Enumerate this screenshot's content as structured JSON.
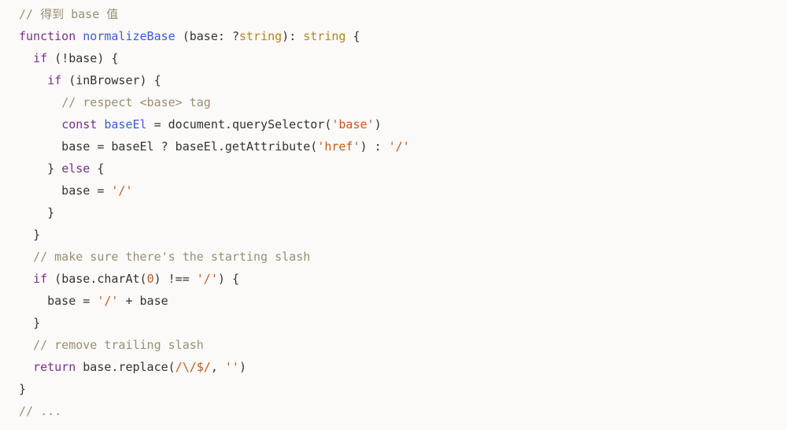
{
  "code": {
    "tokens": [
      [
        [
          "comment",
          "// 得到 base 值"
        ]
      ],
      [
        [
          "keyword",
          "function"
        ],
        [
          "plain",
          " "
        ],
        [
          "funcname",
          "normalizeBase"
        ],
        [
          "plain",
          " "
        ],
        [
          "paren",
          "("
        ],
        [
          "plain",
          "base"
        ],
        [
          "op",
          ":"
        ],
        [
          "plain",
          " "
        ],
        [
          "op",
          "?"
        ],
        [
          "builtin",
          "string"
        ],
        [
          "paren",
          ")"
        ],
        [
          "op",
          ":"
        ],
        [
          "plain",
          " "
        ],
        [
          "builtin",
          "string"
        ],
        [
          "plain",
          " "
        ],
        [
          "paren",
          "{"
        ]
      ],
      [
        [
          "plain",
          "  "
        ],
        [
          "keyword",
          "if"
        ],
        [
          "plain",
          " "
        ],
        [
          "paren",
          "("
        ],
        [
          "op",
          "!"
        ],
        [
          "plain",
          "base"
        ],
        [
          "paren",
          ")"
        ],
        [
          "plain",
          " "
        ],
        [
          "paren",
          "{"
        ]
      ],
      [
        [
          "plain",
          "    "
        ],
        [
          "keyword",
          "if"
        ],
        [
          "plain",
          " "
        ],
        [
          "paren",
          "("
        ],
        [
          "plain",
          "inBrowser"
        ],
        [
          "paren",
          ")"
        ],
        [
          "plain",
          " "
        ],
        [
          "paren",
          "{"
        ]
      ],
      [
        [
          "plain",
          "      "
        ],
        [
          "comment",
          "// respect <base> tag"
        ]
      ],
      [
        [
          "plain",
          "      "
        ],
        [
          "keyword",
          "const"
        ],
        [
          "plain",
          " "
        ],
        [
          "funcname",
          "baseEl"
        ],
        [
          "plain",
          " "
        ],
        [
          "op",
          "="
        ],
        [
          "plain",
          " document"
        ],
        [
          "op",
          "."
        ],
        [
          "plain",
          "querySelector"
        ],
        [
          "paren",
          "("
        ],
        [
          "string",
          "'base'"
        ],
        [
          "paren",
          ")"
        ]
      ],
      [
        [
          "plain",
          "      base "
        ],
        [
          "op",
          "="
        ],
        [
          "plain",
          " baseEl "
        ],
        [
          "op",
          "?"
        ],
        [
          "plain",
          " baseEl"
        ],
        [
          "op",
          "."
        ],
        [
          "plain",
          "getAttribute"
        ],
        [
          "paren",
          "("
        ],
        [
          "string",
          "'href'"
        ],
        [
          "paren",
          ")"
        ],
        [
          "plain",
          " "
        ],
        [
          "op",
          ":"
        ],
        [
          "plain",
          " "
        ],
        [
          "string",
          "'/'"
        ]
      ],
      [
        [
          "plain",
          "    "
        ],
        [
          "paren",
          "}"
        ],
        [
          "plain",
          " "
        ],
        [
          "keyword",
          "else"
        ],
        [
          "plain",
          " "
        ],
        [
          "paren",
          "{"
        ]
      ],
      [
        [
          "plain",
          "      base "
        ],
        [
          "op",
          "="
        ],
        [
          "plain",
          " "
        ],
        [
          "string",
          "'/'"
        ]
      ],
      [
        [
          "plain",
          "    "
        ],
        [
          "paren",
          "}"
        ]
      ],
      [
        [
          "plain",
          "  "
        ],
        [
          "paren",
          "}"
        ]
      ],
      [
        [
          "plain",
          "  "
        ],
        [
          "comment",
          "// make sure there's the starting slash"
        ]
      ],
      [
        [
          "plain",
          "  "
        ],
        [
          "keyword",
          "if"
        ],
        [
          "plain",
          " "
        ],
        [
          "paren",
          "("
        ],
        [
          "plain",
          "base"
        ],
        [
          "op",
          "."
        ],
        [
          "plain",
          "charAt"
        ],
        [
          "paren",
          "("
        ],
        [
          "number",
          "0"
        ],
        [
          "paren",
          ")"
        ],
        [
          "plain",
          " "
        ],
        [
          "op",
          "!=="
        ],
        [
          "plain",
          " "
        ],
        [
          "string",
          "'/'"
        ],
        [
          "paren",
          ")"
        ],
        [
          "plain",
          " "
        ],
        [
          "paren",
          "{"
        ]
      ],
      [
        [
          "plain",
          "    base "
        ],
        [
          "op",
          "="
        ],
        [
          "plain",
          " "
        ],
        [
          "string",
          "'/'"
        ],
        [
          "plain",
          " "
        ],
        [
          "op",
          "+"
        ],
        [
          "plain",
          " base"
        ]
      ],
      [
        [
          "plain",
          "  "
        ],
        [
          "paren",
          "}"
        ]
      ],
      [
        [
          "plain",
          "  "
        ],
        [
          "comment",
          "// remove trailing slash"
        ]
      ],
      [
        [
          "plain",
          "  "
        ],
        [
          "keyword",
          "return"
        ],
        [
          "plain",
          " base"
        ],
        [
          "op",
          "."
        ],
        [
          "plain",
          "replace"
        ],
        [
          "paren",
          "("
        ],
        [
          "string",
          "/\\/$/"
        ],
        [
          "op",
          ","
        ],
        [
          "plain",
          " "
        ],
        [
          "string",
          "''"
        ],
        [
          "paren",
          ")"
        ]
      ],
      [
        [
          "paren",
          "}"
        ]
      ],
      [
        [
          "comment",
          "// ..."
        ]
      ]
    ]
  }
}
